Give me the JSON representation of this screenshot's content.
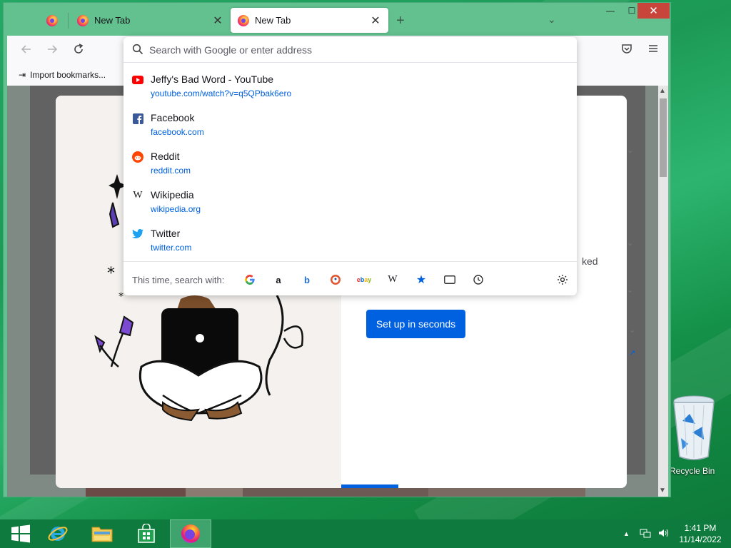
{
  "browser": {
    "tabs": [
      {
        "label": "New Tab"
      },
      {
        "label": "New Tab",
        "active": true
      }
    ],
    "tab_close_glyph": "✕",
    "new_tab_glyph": "+",
    "tablist_glyph": "⌄",
    "window_controls": {
      "minimize": "—",
      "maximize": "☐",
      "close": "✕"
    },
    "bookmarks_toolbar": {
      "import_label": "Import bookmarks..."
    }
  },
  "urlbar": {
    "placeholder": "Search with Google or enter address",
    "value": ""
  },
  "suggestions": [
    {
      "title": "Jeffy's Bad Word - YouTube",
      "url": "youtube.com/watch?v=q5QPbak6ero",
      "icon": "youtube-icon"
    },
    {
      "title": "Facebook",
      "url": "facebook.com",
      "icon": "facebook-icon"
    },
    {
      "title": "Reddit",
      "url": "reddit.com",
      "icon": "reddit-icon"
    },
    {
      "title": "Wikipedia",
      "url": "wikipedia.org",
      "icon": "wikipedia-icon"
    },
    {
      "title": "Twitter",
      "url": "twitter.com",
      "icon": "twitter-icon"
    }
  ],
  "one_off_search": {
    "label": "This time, search with:",
    "engines": [
      "google-icon",
      "amazon-icon",
      "bing-icon",
      "duckduckgo-icon",
      "ebay-icon",
      "wikipedia-icon",
      "bookmarks-icon",
      "tabs-icon",
      "history-icon"
    ],
    "settings_icon": "gear-icon"
  },
  "page": {
    "setup_button": "Set up in seconds",
    "partial_text": "ked"
  },
  "desktop": {
    "recycle_bin_label": "Recycle Bin"
  },
  "taskbar": {
    "clock_time": "1:41 PM",
    "clock_date": "11/14/2022"
  },
  "colors": {
    "accent": "#0061e0",
    "window_frame": "#62c18f",
    "taskbar": "#0e7a3d",
    "close_button": "#c7453b"
  }
}
